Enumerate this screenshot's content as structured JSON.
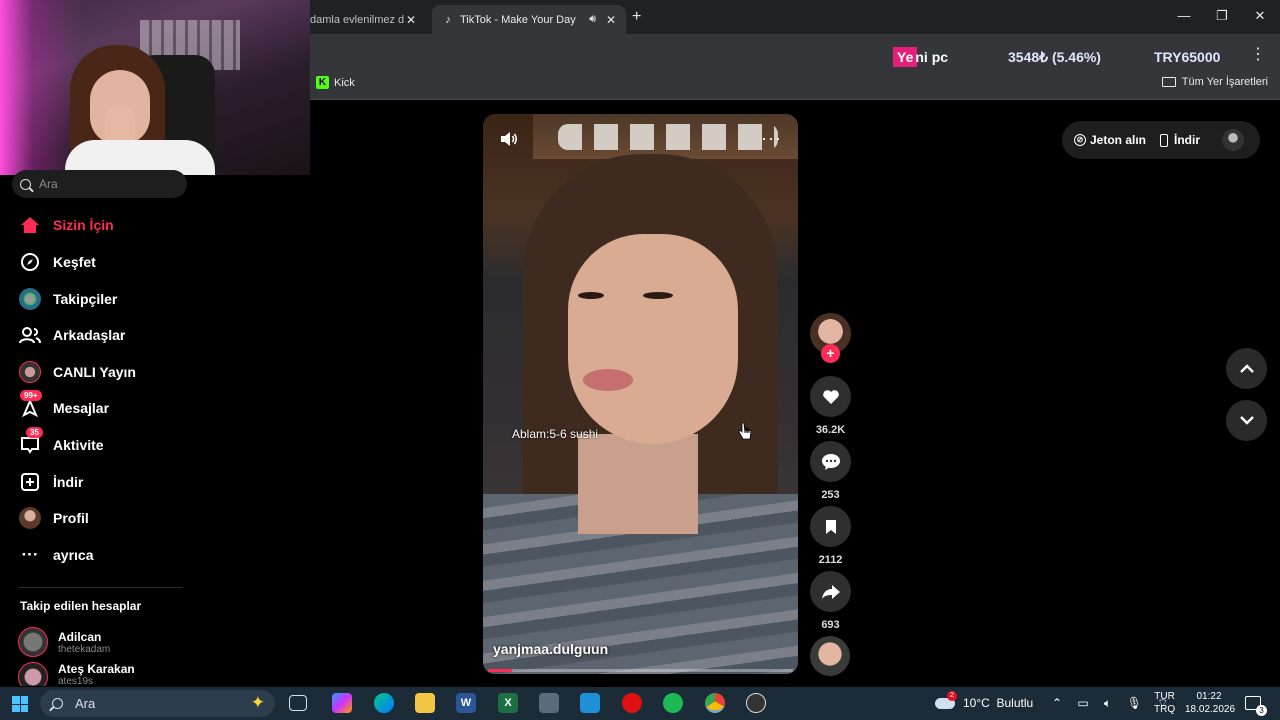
{
  "browser": {
    "tabs": [
      {
        "label": "damla evlenilmez d",
        "close": "✕"
      },
      {
        "label": "TikTok - Make Your Day",
        "close": "✕",
        "active": true
      }
    ],
    "new_tab": "+",
    "window_controls": {
      "minimize": "—",
      "maximize": "❐",
      "close": "✕"
    },
    "menu_icon": "⋮",
    "bookmarks": {
      "kick": "Kick",
      "all_bookmarks": "Tüm Yer İşaretleri"
    }
  },
  "stream_overlay": {
    "highlight": "Ye",
    "label_rest": "ni pc",
    "price": "3548₺ (5.46%)",
    "target": "TRY65000"
  },
  "tiktok": {
    "search_placeholder": "Ara",
    "nav": [
      {
        "label": "Sizin İçin",
        "icon": "home-icon",
        "active": true
      },
      {
        "label": "Keşfet",
        "icon": "compass-icon"
      },
      {
        "label": "Takipçiler",
        "icon": "followers-avatar"
      },
      {
        "label": "Arkadaşlar",
        "icon": "friends-icon"
      },
      {
        "label": "CANLI Yayın",
        "icon": "live-avatar"
      },
      {
        "label": "Mesajlar",
        "icon": "messages-icon",
        "badge": "99+"
      },
      {
        "label": "Aktivite",
        "icon": "activity-icon",
        "badge": "35"
      },
      {
        "label": "İndir",
        "icon": "download-plus-icon"
      },
      {
        "label": "Profil",
        "icon": "profile-avatar"
      },
      {
        "label": "ayrıca",
        "icon": "more-dots-icon"
      }
    ],
    "following_title": "Takip edilen hesaplar",
    "following": [
      {
        "name": "Adilcan",
        "handle": "thetekadam"
      },
      {
        "name": "Ateş Karakan",
        "handle": "ates19s"
      }
    ],
    "video": {
      "caption_overlay": "Ablam:5-6 sushi",
      "author": "yanjmaa.dulguun",
      "progress": 0.08
    },
    "actions": {
      "likes": "36.2K",
      "comments": "253",
      "saves": "2112",
      "shares": "693"
    },
    "top_right": {
      "coins": "Jeton alın",
      "download": "İndir"
    }
  },
  "taskbar": {
    "search_placeholder": "Ara",
    "weather": "10°C  Bulutlu",
    "weather_badge": "2",
    "lang_top": "TUR",
    "lang_bottom": "TRQ",
    "time": "01:22",
    "date": "18.02.2026",
    "notifications": "3"
  },
  "colors": {
    "accent": "#fe2c55",
    "kick": "#53fc18",
    "overlay_pink": "#e6207a"
  }
}
